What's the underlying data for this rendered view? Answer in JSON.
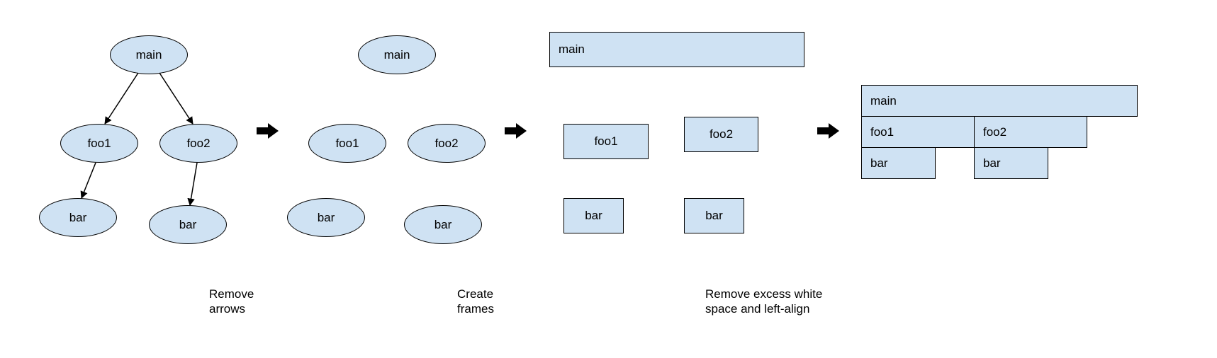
{
  "colors": {
    "node_fill": "#cfe2f3",
    "node_stroke": "#000000",
    "arrow_fill": "#000000",
    "bg": "#ffffff"
  },
  "panels": {
    "panel1": {
      "type": "call-tree",
      "nodes": {
        "main": {
          "label": "main"
        },
        "foo1": {
          "label": "foo1"
        },
        "foo2": {
          "label": "foo2"
        },
        "bar_l": {
          "label": "bar"
        },
        "bar_r": {
          "label": "bar"
        }
      },
      "edges": [
        {
          "from": "main",
          "to": "foo1"
        },
        {
          "from": "main",
          "to": "foo2"
        },
        {
          "from": "foo1",
          "to": "bar_l"
        },
        {
          "from": "foo2",
          "to": "bar_r"
        }
      ]
    },
    "panel2": {
      "type": "nodes-only",
      "nodes": {
        "main": {
          "label": "main"
        },
        "foo1": {
          "label": "foo1"
        },
        "foo2": {
          "label": "foo2"
        },
        "bar_l": {
          "label": "bar"
        },
        "bar_r": {
          "label": "bar"
        }
      }
    },
    "panel3": {
      "type": "frames",
      "nodes": {
        "main": {
          "label": "main"
        },
        "foo1": {
          "label": "foo1"
        },
        "foo2": {
          "label": "foo2"
        },
        "bar_l": {
          "label": "bar"
        },
        "bar_r": {
          "label": "bar"
        }
      }
    },
    "panel4": {
      "type": "flamegraph",
      "nodes": {
        "main": {
          "label": "main"
        },
        "foo1": {
          "label": "foo1"
        },
        "foo2": {
          "label": "foo2"
        },
        "bar_l": {
          "label": "bar"
        },
        "bar_r": {
          "label": "bar"
        }
      }
    }
  },
  "transitions": {
    "t1": {
      "caption_line1": "Remove",
      "caption_line2": "arrows"
    },
    "t2": {
      "caption_line1": "Create",
      "caption_line2": "frames"
    },
    "t3": {
      "caption_line1": "Remove excess white",
      "caption_line2": "space and left-align"
    }
  }
}
